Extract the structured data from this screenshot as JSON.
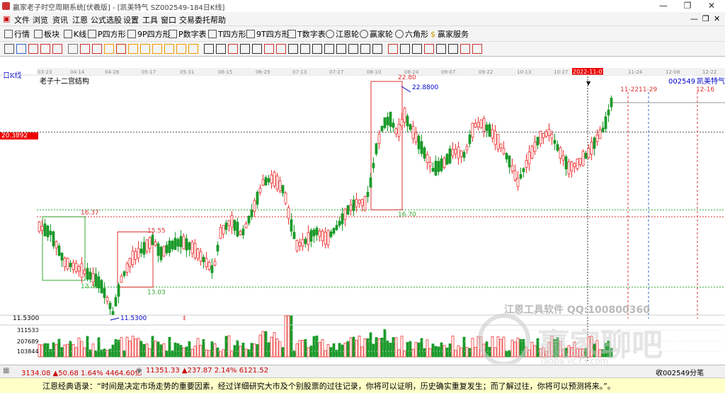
{
  "window": {
    "title": "赢家老子时空周期系统[伏羲版] - [凯美特气  SZ002549-184日K线]",
    "controls": [
      "—",
      "❐",
      "✕"
    ]
  },
  "menu": [
    "文件",
    "浏览",
    "资讯",
    "江恩",
    "公式选股",
    "设置",
    "工具",
    "窗口",
    "交易委托",
    "帮助"
  ],
  "toolbar": [
    "行情",
    "板块",
    "K线",
    "P四方形",
    "9P四方形",
    "P数字表",
    "T四方形",
    "9T四方形",
    "T数字表",
    "江恩轮",
    "赢家轮",
    "六角形",
    "赢家服务"
  ],
  "chart_data": {
    "type": "candlestick",
    "period_label": "日K线",
    "structure_label": "老子十二宫结构",
    "stock_code": "002549",
    "stock_name": "凯美特气",
    "date_ticks": [
      "03-23",
      "04-14",
      "04-28",
      "05-17",
      "05-31",
      "06-15",
      "06-29",
      "07-13",
      "07-27",
      "08-10",
      "08-24",
      "09-07",
      "09-22",
      "10-13",
      "10-27",
      "2022-11-07",
      "11-24",
      "12-08",
      "12-22"
    ],
    "highlighted_date": "2022-11-07",
    "future_dates": [
      "11-22",
      "11-29",
      "12-16"
    ],
    "crosshair_price": "20.3892",
    "price_levels": {
      "peak": "22.80",
      "peak_marker": "22.8800",
      "box_top_1": "16.37",
      "box_bottom_1": "13.35",
      "box_top_2": "15.55",
      "box_bottom_2": "13.03",
      "box_bottom_3": "16.70",
      "low": "11.5300"
    },
    "axis_price_min": "11.5300",
    "volume_ticks": [
      "311533",
      "207689",
      "103844"
    ],
    "ylim": [
      11.0,
      23.5
    ]
  },
  "watermark": {
    "line1": "江恩工具软件  QQ:100800360",
    "line2": "赢家聊吧",
    "line3": "laoba.yc33.com"
  },
  "status": {
    "sh": "3134.08 ▲50.68 1.64% 4464.60亿",
    "sz": "11351.33 ▲237.87 2.14% 6121.52",
    "right": "收002549分笔"
  },
  "quote": "江恩经典语录：“时间是决定市场走势的重要因素，经过详细研究大市及个别股票的过往记录，你将可以证明，历史确实重复发生；而了解过往，你将可以预测将来。”。"
}
